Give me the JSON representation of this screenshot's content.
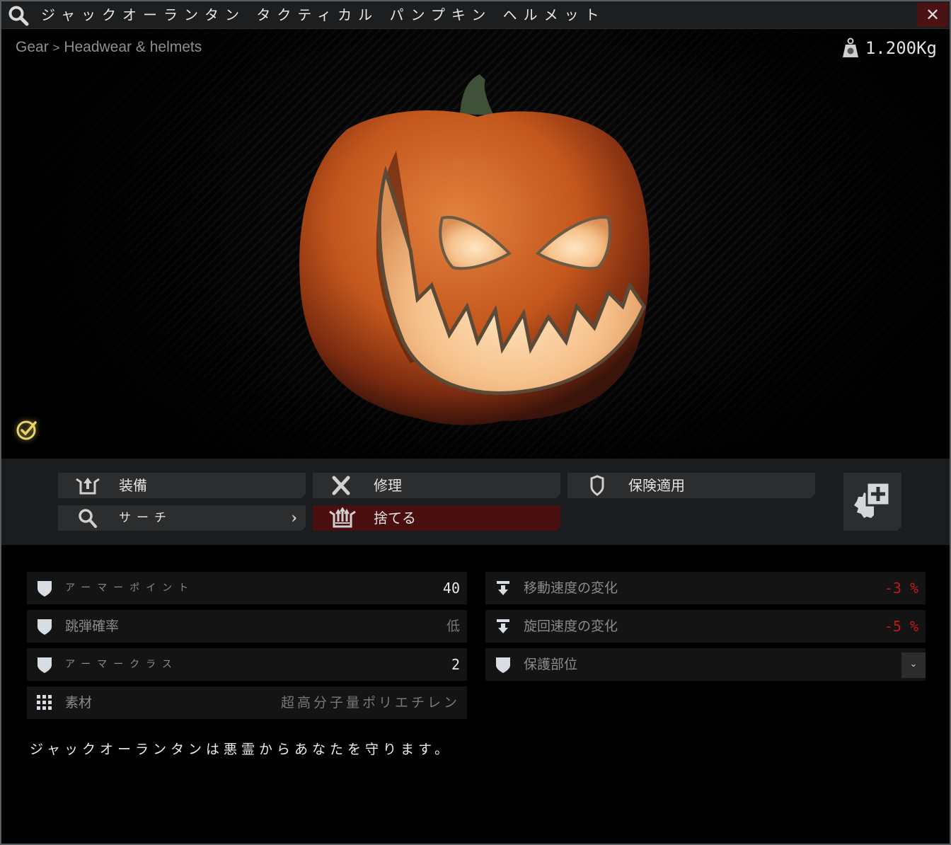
{
  "window": {
    "title": "ジャックオーランタン タクティカル パンプキン ヘルメット",
    "close_label": "✕"
  },
  "viewer": {
    "breadcrumb": [
      "Gear",
      "Headwear & helmets"
    ],
    "breadcrumb_separator": ">",
    "weight": "1.200Kg",
    "examined": true
  },
  "actions": {
    "buttons": [
      {
        "label": "装備",
        "icon": "equip-icon"
      },
      {
        "label": "修理",
        "icon": "repair-icon"
      },
      {
        "label": "保険適用",
        "icon": "insure-shield-icon"
      },
      {
        "label": "サーチ",
        "icon": "search-icon",
        "has_submenu": true
      },
      {
        "label": "捨てる",
        "icon": "discard-icon",
        "danger": true
      }
    ],
    "modding_button": "modding-icon",
    "colors": {
      "danger": "#4a1011",
      "button": "#2b2d2e"
    }
  },
  "stats": {
    "left": [
      {
        "name": "アーマーポイント",
        "value": "40",
        "icon": "shield-icon"
      },
      {
        "name": "跳弾確率",
        "value": "低",
        "icon": "shield-icon"
      },
      {
        "name": "アーマークラス",
        "value": "2",
        "icon": "shield-icon"
      },
      {
        "name": "素材",
        "value": "超高分子量ポリエチレン",
        "icon": "material-grid-icon"
      }
    ],
    "right": [
      {
        "name": "移動速度の変化",
        "value": "-3 %",
        "icon": "speed-down-icon",
        "color": "#c0191a"
      },
      {
        "name": "旋回速度の変化",
        "value": "-5 %",
        "icon": "speed-down-icon",
        "color": "#c0191a"
      },
      {
        "name": "保護部位",
        "value": "",
        "icon": "shield-icon",
        "expandable": true
      }
    ]
  },
  "description": "ジャックオーランタンは悪霊からあなたを守ります。"
}
